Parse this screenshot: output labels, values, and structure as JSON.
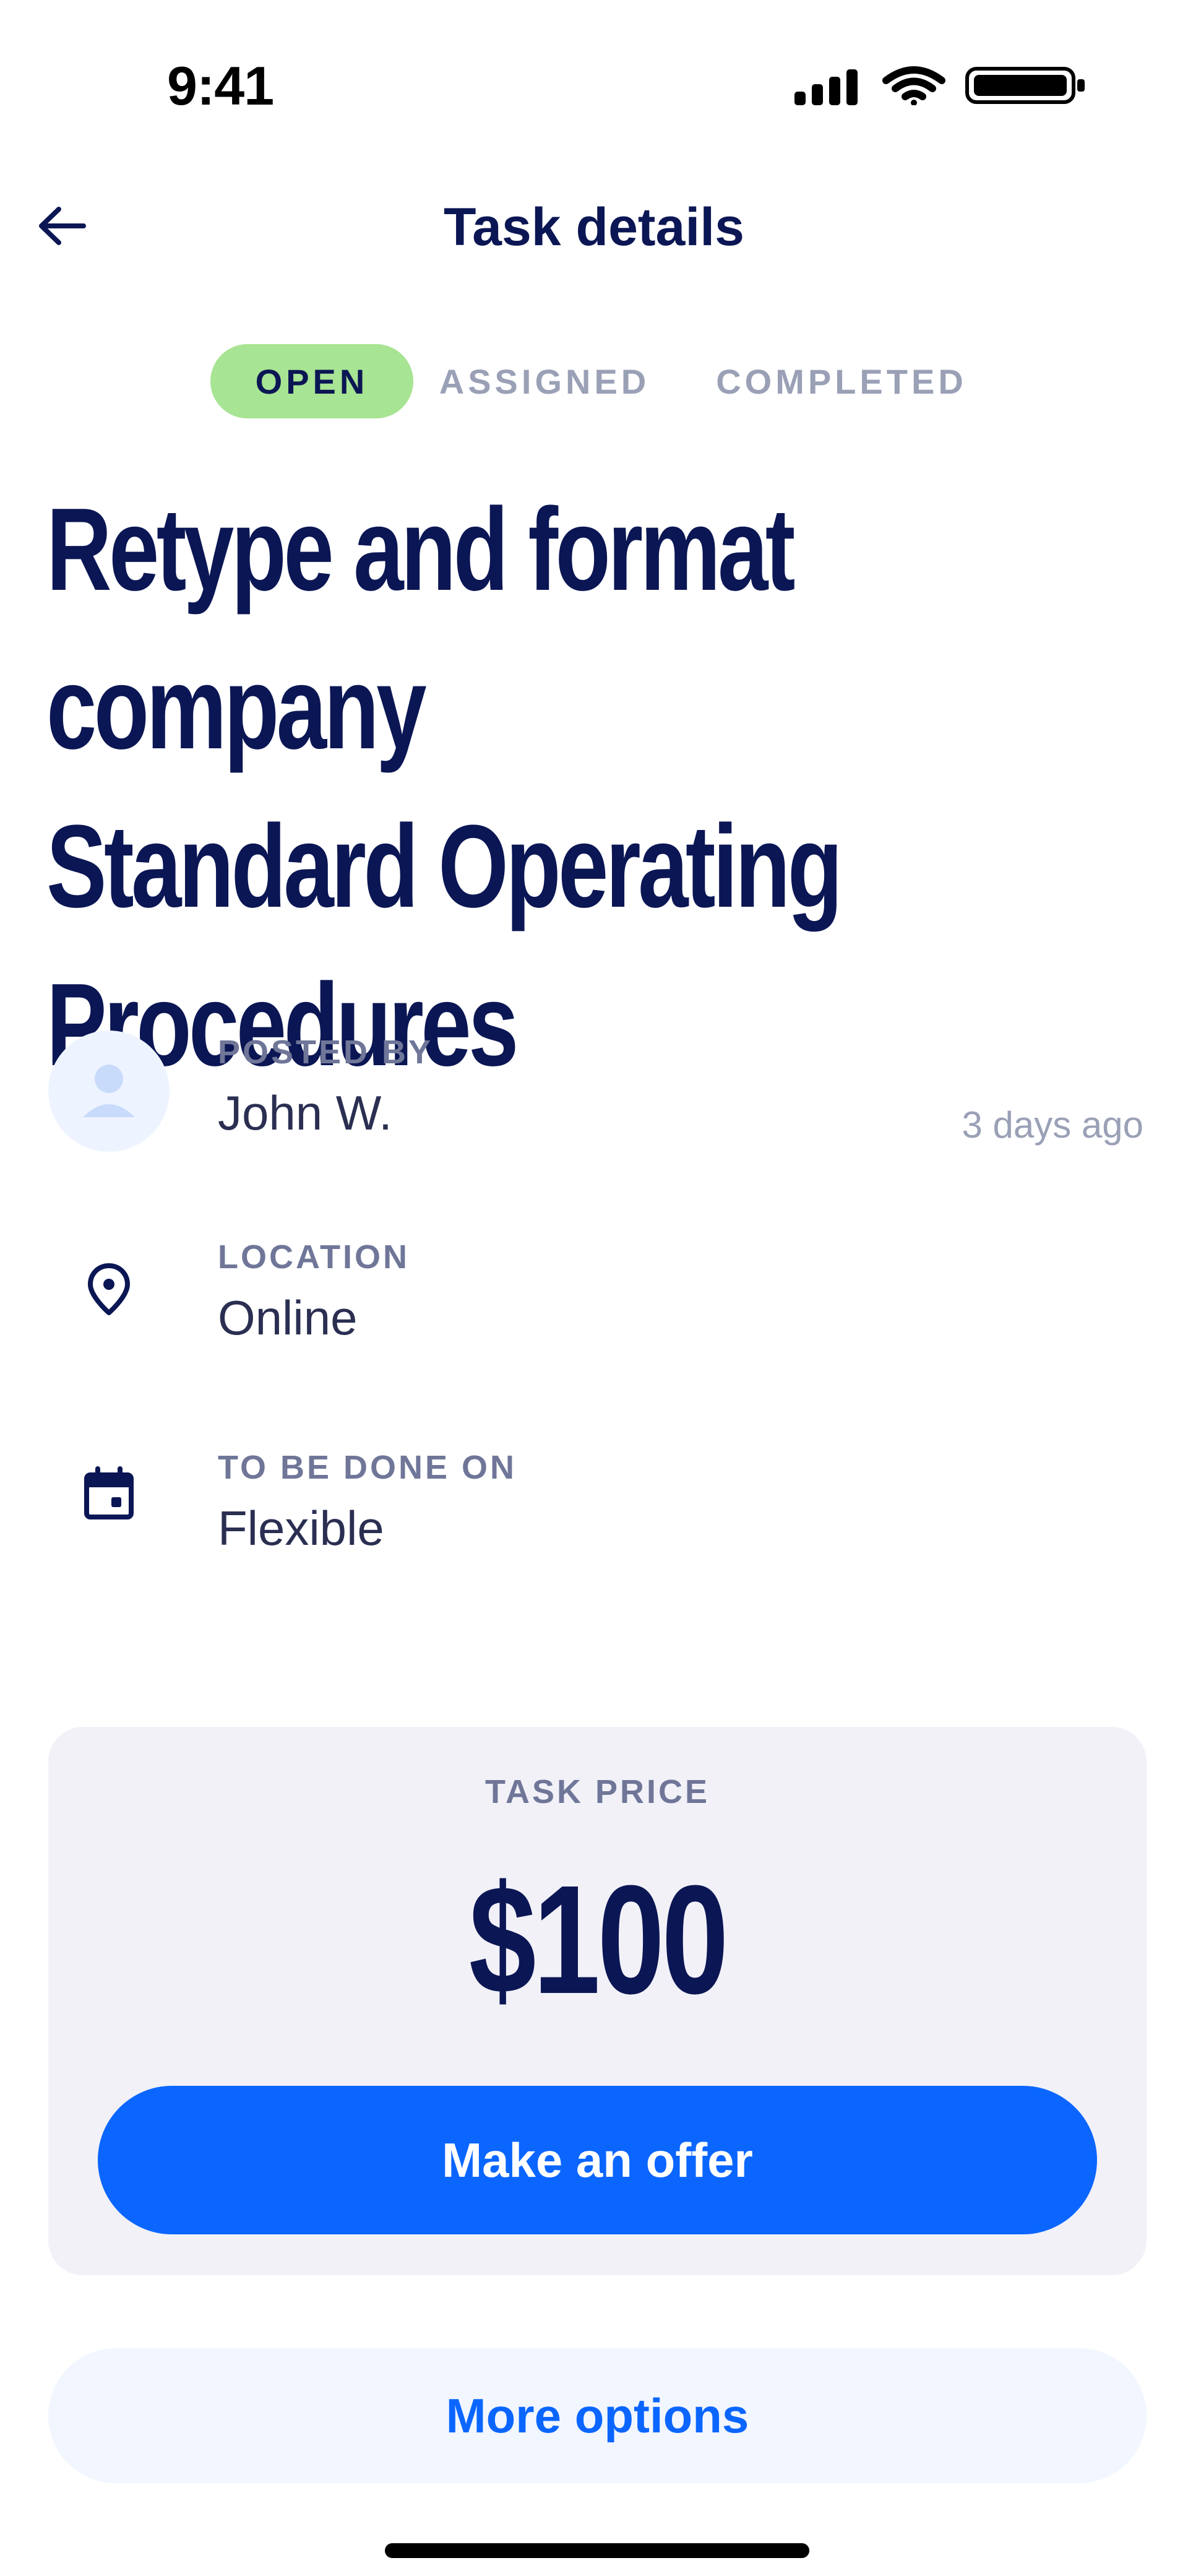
{
  "status_bar": {
    "time": "9:41"
  },
  "header": {
    "title": "Task details"
  },
  "status_tabs": {
    "open": "OPEN",
    "assigned": "ASSIGNED",
    "completed": "COMPLETED",
    "active": "open"
  },
  "task": {
    "title": "Retype and format company\nStandard Operating\nProcedures"
  },
  "details": {
    "posted_by_label": "POSTED BY",
    "posted_by_value": "John W.",
    "posted_time": "3 days ago",
    "location_label": "LOCATION",
    "location_value": "Online",
    "due_label": "TO BE DONE ON",
    "due_value": "Flexible"
  },
  "price": {
    "label": "TASK PRICE",
    "value": "$100",
    "offer_button": "Make an offer"
  },
  "more_options": "More options",
  "colors": {
    "primary_blue": "#0b66ff",
    "navy_text": "#0b1654",
    "open_badge": "#a7e493"
  }
}
